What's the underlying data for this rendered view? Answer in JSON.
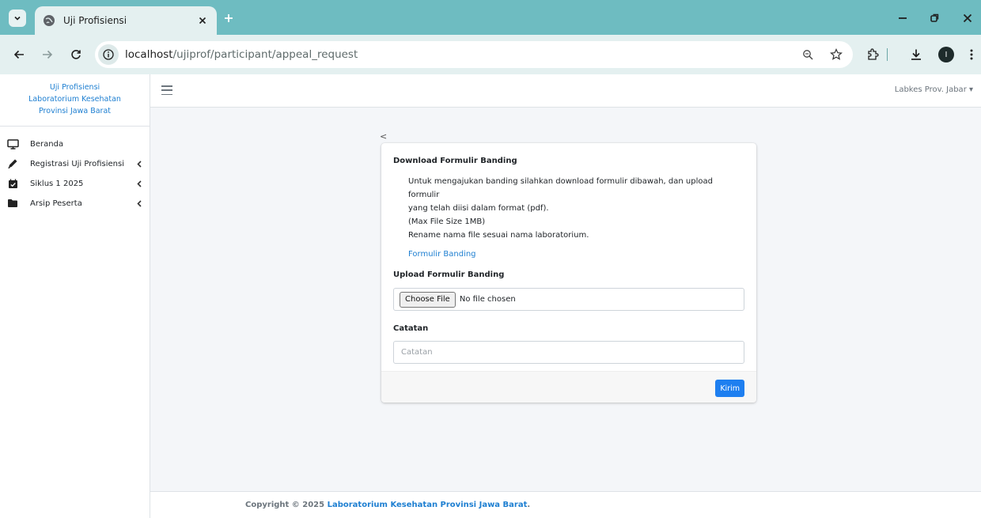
{
  "browser": {
    "tab_title": "Uji Profisiensi",
    "url_host": "localhost",
    "url_path": "/ujiprof/participant/appeal_request",
    "profile_initial": "I"
  },
  "sidebar": {
    "brand_lines": [
      "Uji Profisiensi",
      "Laboratorium Kesehatan",
      "Provinsi Jawa Barat"
    ],
    "items": [
      {
        "label": "Beranda",
        "icon": "desktop-icon"
      },
      {
        "label": "Registrasi Uji Profisiensi",
        "icon": "pen-icon"
      },
      {
        "label": "Siklus 1 2025",
        "icon": "calendar-check-icon"
      },
      {
        "label": "Arsip Peserta",
        "icon": "folder-icon"
      }
    ]
  },
  "topnav": {
    "user_label": "Labkes Prov. Jabar ▾"
  },
  "main": {
    "back_label": "<",
    "download_heading": "Download Formulir Banding",
    "instructions": [
      "Untuk mengajukan banding silahkan download formulir dibawah, dan upload formulir",
      "yang telah diisi dalam format (pdf).",
      "(Max File Size 1MB)",
      "Rename nama file sesuai nama laboratorium."
    ],
    "form_link": "Formulir Banding",
    "upload_heading": "Upload Formulir Banding",
    "file_button": "Choose File",
    "file_status": "No file chosen",
    "catatan_heading": "Catatan",
    "catatan_placeholder": "Catatan",
    "catatan_value": "",
    "submit_label": "Kirim"
  },
  "footer": {
    "prefix": "Copyright © 2025 ",
    "org": "Laboratorium Kesehatan Provinsi Jawa Barat",
    "suffix": "."
  },
  "colors": {
    "titlebar": "#6ebcc1",
    "toolbar": "#e4f0f0",
    "accent": "#1e7fd1",
    "submit": "#1e7ff0"
  }
}
